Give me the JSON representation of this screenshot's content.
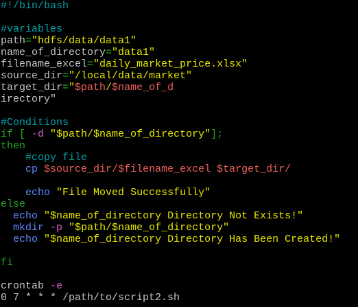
{
  "colors": {
    "background": "#000000",
    "comment": "#06a0a8",
    "text": "#c6c6c6",
    "string": "#e6e600",
    "variable": "#f0605a",
    "keyword": "#22a822",
    "option": "#d65fd6",
    "command": "#5f87ff"
  },
  "lines": [
    [
      {
        "t": "comment",
        "s": "#!/bin/bash"
      }
    ],
    [],
    [
      {
        "t": "comment",
        "s": "#variables"
      }
    ],
    [
      {
        "t": "text",
        "s": "path"
      },
      {
        "t": "eq",
        "s": "="
      },
      {
        "t": "str",
        "s": "\"hdfs/data/data1\""
      }
    ],
    [
      {
        "t": "text",
        "s": "name_of_directory"
      },
      {
        "t": "eq",
        "s": "="
      },
      {
        "t": "str",
        "s": "\"data1\""
      }
    ],
    [
      {
        "t": "text",
        "s": "filename_excel"
      },
      {
        "t": "eq",
        "s": "="
      },
      {
        "t": "str",
        "s": "\"daily_market_price.xlsx\""
      }
    ],
    [
      {
        "t": "text",
        "s": "source_dir"
      },
      {
        "t": "eq",
        "s": "="
      },
      {
        "t": "str",
        "s": "\"/local/data/market\""
      }
    ],
    [
      {
        "t": "text",
        "s": "target_dir"
      },
      {
        "t": "eq",
        "s": "="
      },
      {
        "t": "str",
        "s": "\""
      },
      {
        "t": "var",
        "s": "$path"
      },
      {
        "t": "str",
        "s": "/"
      },
      {
        "t": "var",
        "s": "$name_of_d"
      }
    ],
    [
      {
        "t": "text",
        "s": "irectory\""
      }
    ],
    [],
    [
      {
        "t": "comment",
        "s": "#Conditions"
      }
    ],
    [
      {
        "t": "kw",
        "s": "if [ "
      },
      {
        "t": "opt",
        "s": "-d"
      },
      {
        "t": "text",
        "s": " "
      },
      {
        "t": "str",
        "s": "\"$path/$name_of_directory\""
      },
      {
        "t": "kw",
        "s": "];"
      }
    ],
    [
      {
        "t": "kw",
        "s": "then"
      }
    ],
    [
      {
        "t": "text",
        "s": "    "
      },
      {
        "t": "comment",
        "s": "#copy file"
      }
    ],
    [
      {
        "t": "text",
        "s": "    "
      },
      {
        "t": "cmd",
        "s": "cp"
      },
      {
        "t": "text",
        "s": " "
      },
      {
        "t": "var",
        "s": "$source_dir/$filename_excel $target_dir/"
      }
    ],
    [],
    [
      {
        "t": "text",
        "s": "    "
      },
      {
        "t": "cmd",
        "s": "echo"
      },
      {
        "t": "text",
        "s": " "
      },
      {
        "t": "str",
        "s": "\"File Moved Successfully\""
      }
    ],
    [
      {
        "t": "kw",
        "s": "else"
      }
    ],
    [
      {
        "t": "text",
        "s": "  "
      },
      {
        "t": "cmd",
        "s": "echo"
      },
      {
        "t": "text",
        "s": " "
      },
      {
        "t": "str",
        "s": "\"$name_of_directory Directory Not Exists!\""
      }
    ],
    [
      {
        "t": "text",
        "s": "  "
      },
      {
        "t": "cmd",
        "s": "mkdir"
      },
      {
        "t": "text",
        "s": " "
      },
      {
        "t": "opt",
        "s": "-p"
      },
      {
        "t": "text",
        "s": " "
      },
      {
        "t": "str",
        "s": "\"$path/$name_of_directory\""
      }
    ],
    [
      {
        "t": "text",
        "s": "  "
      },
      {
        "t": "cmd",
        "s": "echo"
      },
      {
        "t": "text",
        "s": " "
      },
      {
        "t": "str",
        "s": "\"$name_of_directory Directory Has Been Created!\""
      }
    ],
    [],
    [
      {
        "t": "kw",
        "s": "fi"
      }
    ],
    [],
    [
      {
        "t": "text",
        "s": "crontab "
      },
      {
        "t": "opt",
        "s": "-e"
      }
    ],
    [
      {
        "t": "text",
        "s": "0 7 * * * /path/to/script2.sh"
      }
    ]
  ]
}
